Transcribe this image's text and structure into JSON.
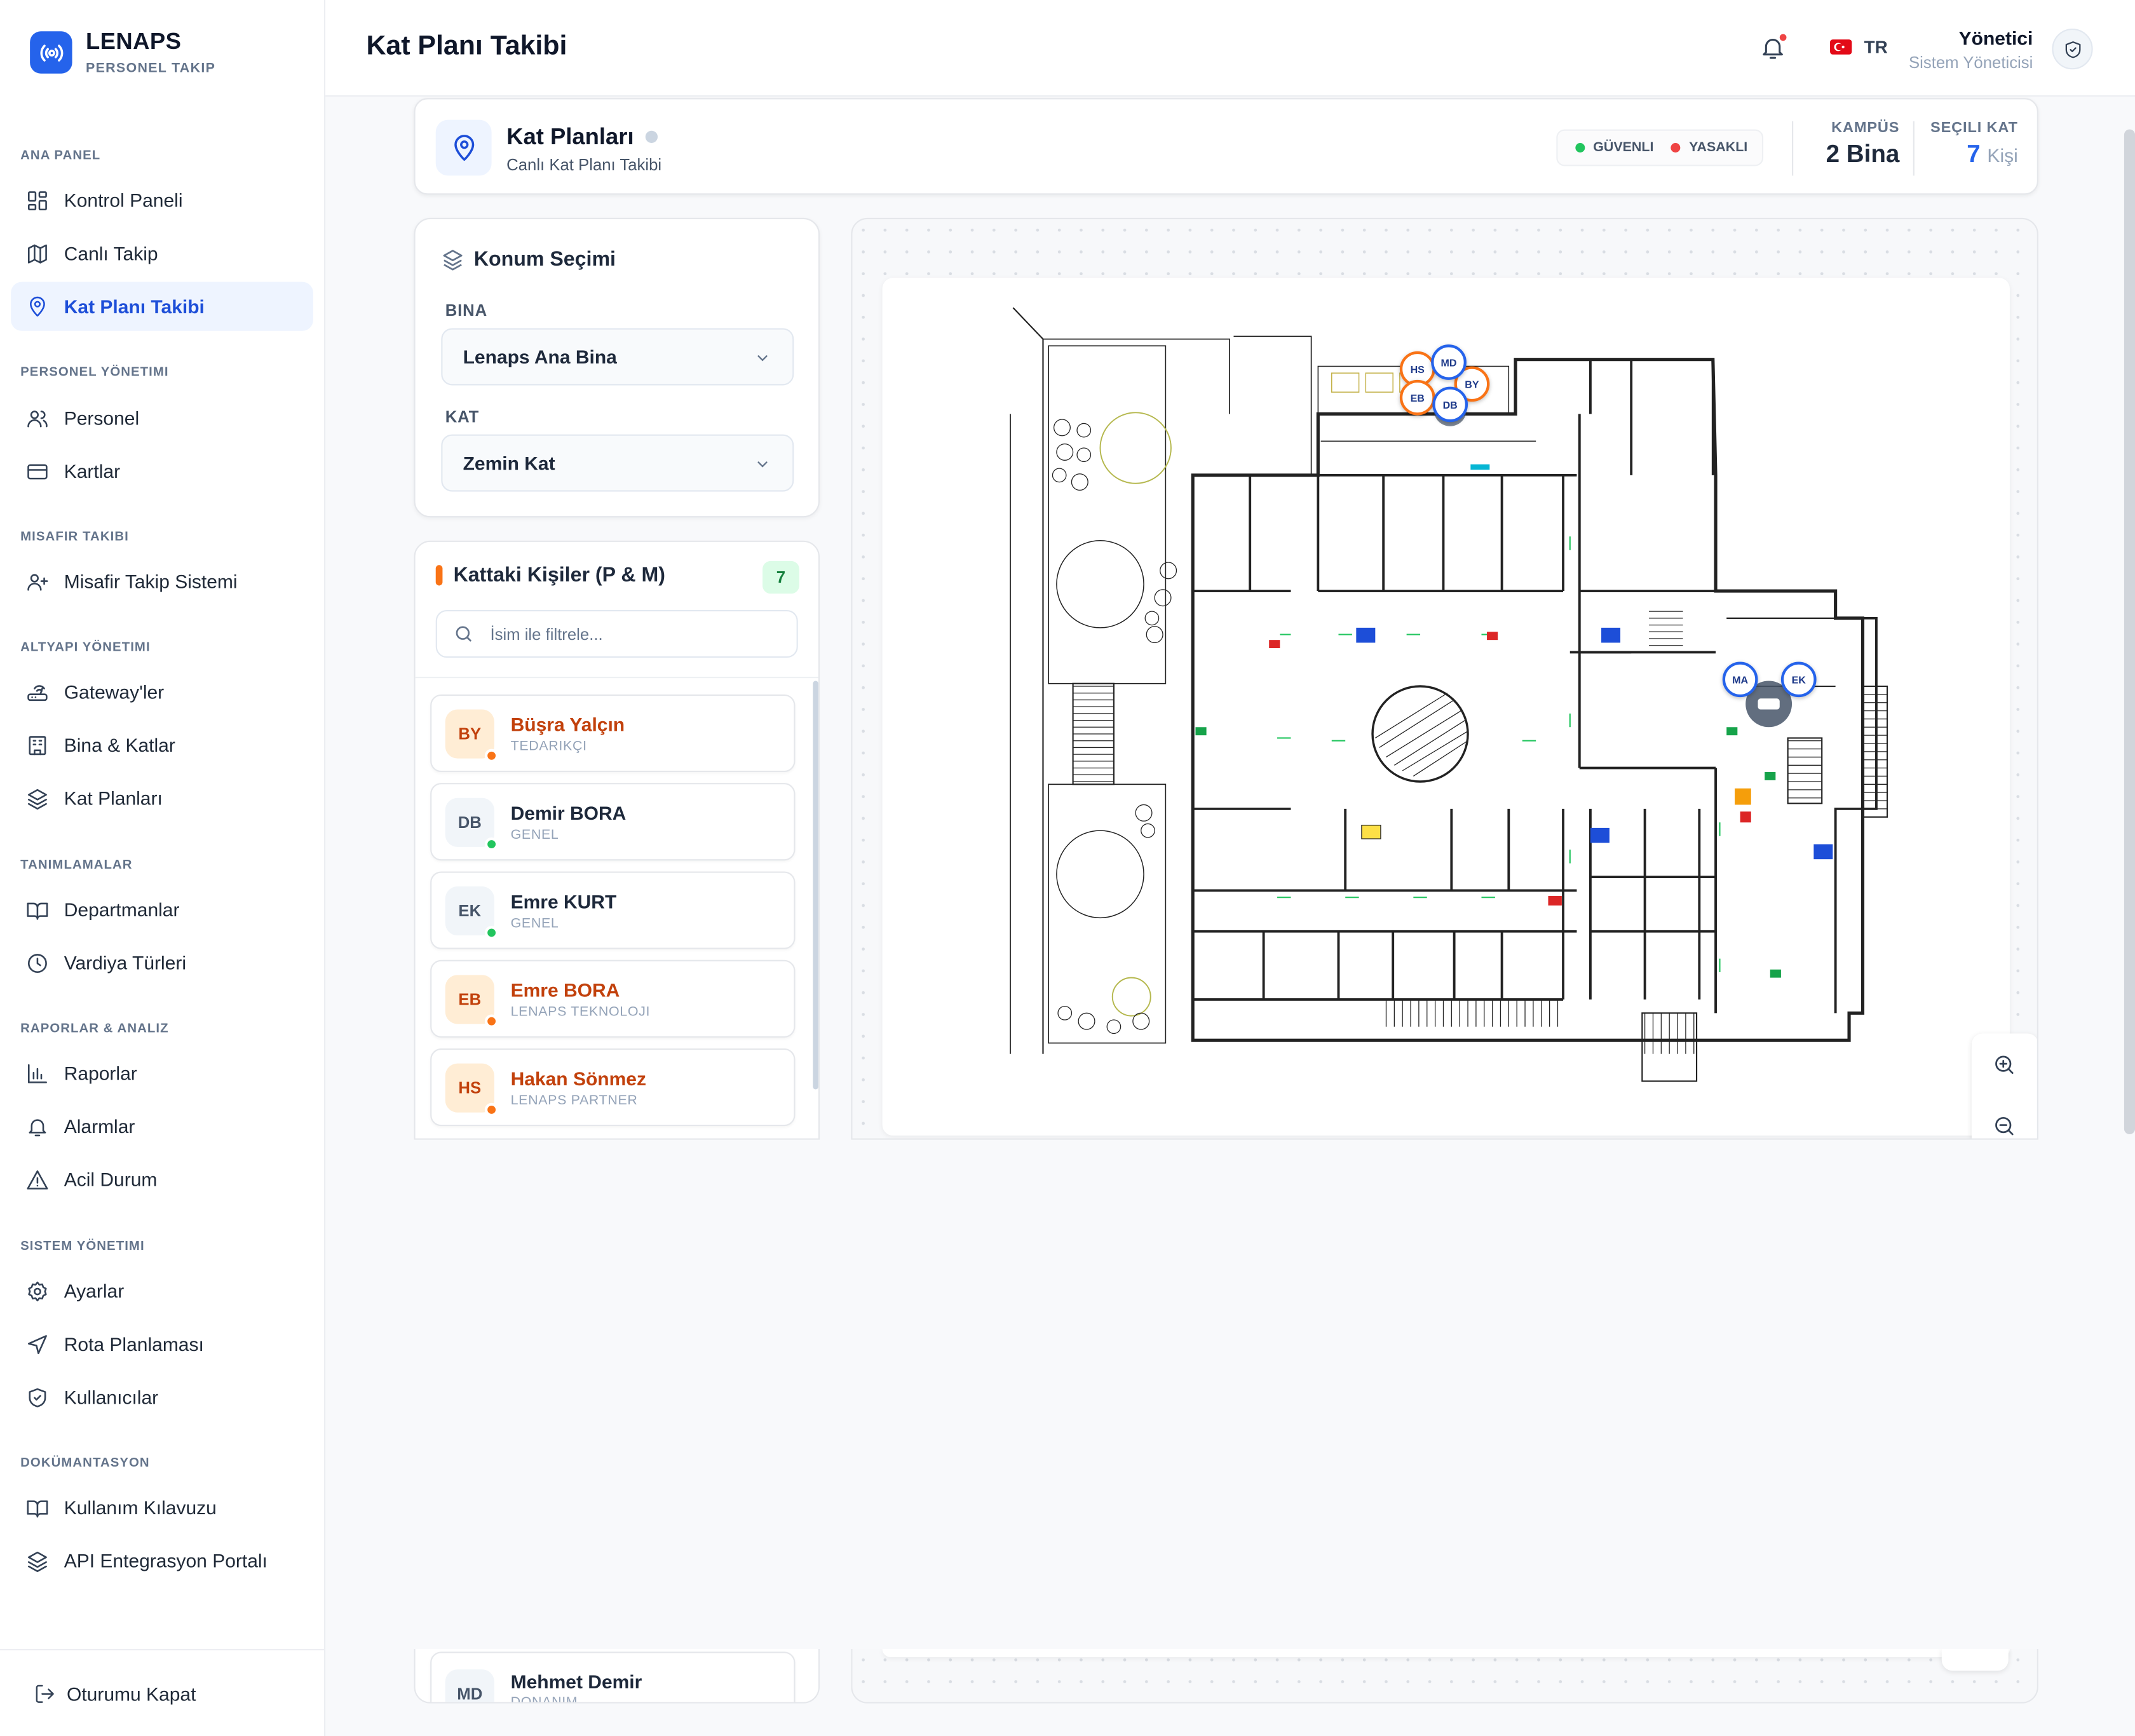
{
  "brand": {
    "title": "LENAPS",
    "subtitle": "PERSONEL TAKIP"
  },
  "sidebar": {
    "sections": [
      {
        "label": "ANA PANEL",
        "items": [
          {
            "label": "Kontrol Paneli",
            "icon": "dashboard-icon"
          },
          {
            "label": "Canlı Takip",
            "icon": "map-icon"
          },
          {
            "label": "Kat Planı Takibi",
            "icon": "map-pin-icon",
            "active": true
          }
        ]
      },
      {
        "label": "PERSONEL YÖNETIMI",
        "items": [
          {
            "label": "Personel",
            "icon": "users-icon"
          },
          {
            "label": "Kartlar",
            "icon": "credit-card-icon"
          }
        ]
      },
      {
        "label": "MISAFIR TAKIBI",
        "items": [
          {
            "label": "Misafir Takip Sistemi",
            "icon": "user-plus-icon"
          }
        ]
      },
      {
        "label": "ALTYAPI YÖNETIMI",
        "items": [
          {
            "label": "Gateway'ler",
            "icon": "router-icon"
          },
          {
            "label": "Bina & Katlar",
            "icon": "building-icon"
          },
          {
            "label": "Kat Planları",
            "icon": "layers-icon"
          }
        ]
      },
      {
        "label": "TANIMLAMALAR",
        "items": [
          {
            "label": "Departmanlar",
            "icon": "book-open-icon"
          },
          {
            "label": "Vardiya Türleri",
            "icon": "clock-icon"
          }
        ]
      },
      {
        "label": "RAPORLAR & ANALIZ",
        "items": [
          {
            "label": "Raporlar",
            "icon": "bar-chart-icon"
          },
          {
            "label": "Alarmlar",
            "icon": "bell-icon"
          },
          {
            "label": "Acil Durum",
            "icon": "alert-triangle-icon"
          }
        ]
      },
      {
        "label": "SISTEM YÖNETIMI",
        "items": [
          {
            "label": "Ayarlar",
            "icon": "gear-icon"
          },
          {
            "label": "Rota Planlaması",
            "icon": "navigation-icon"
          },
          {
            "label": "Kullanıcılar",
            "icon": "shield-check-icon"
          }
        ]
      },
      {
        "label": "DOKÜMANTASYON",
        "items": [
          {
            "label": "Kullanım Kılavuzu",
            "icon": "book-open-icon"
          },
          {
            "label": "API Entegrasyon Portalı",
            "icon": "layers-icon"
          }
        ]
      }
    ],
    "logout": "Oturumu Kapat"
  },
  "header": {
    "title": "Kat Planı Takibi",
    "language": "TR",
    "user_name": "Yönetici",
    "user_role": "Sistem Yöneticisi"
  },
  "floorplans": {
    "title": "Kat Planları",
    "subtitle": "Canlı Kat Planı Takibi",
    "legend": {
      "safe": "GÜVENLI",
      "forbidden": "YASAKLI"
    },
    "campus_label": "KAMPÜS",
    "campus_value": "2 Bina",
    "floor_label": "SEÇILI KAT",
    "floor_count": "7",
    "floor_unit": "Kişi"
  },
  "location": {
    "title": "Konum Seçimi",
    "building_label": "BINA",
    "building_value": "Lenaps Ana Bina",
    "floor_label": "KAT",
    "floor_value": "Zemin Kat"
  },
  "people": {
    "title": "Kattaki Kişiler (P & M)",
    "count": "7",
    "search_placeholder": "İsim ile filtrele...",
    "list": [
      {
        "initials": "BY",
        "name": "Büşra Yalçın",
        "dept": "TEDARIKÇI",
        "guest": true
      },
      {
        "initials": "DB",
        "name": "Demir BORA",
        "dept": "GENEL",
        "guest": false
      },
      {
        "initials": "EK",
        "name": "Emre KURT",
        "dept": "GENEL",
        "guest": false
      },
      {
        "initials": "EB",
        "name": "Emre BORA",
        "dept": "LENAPS TEKNOLOJI",
        "guest": true
      },
      {
        "initials": "HS",
        "name": "Hakan Sönmez",
        "dept": "LENAPS PARTNER",
        "guest": true
      }
    ],
    "partial": {
      "initials": "MD",
      "name": "Mehmet Demir",
      "dept": "DONANIM"
    }
  },
  "map_markers": [
    "HS",
    "MD",
    "EB",
    "DB",
    "BY",
    "MA",
    "EK"
  ],
  "colors": {
    "accent": "#2563eb",
    "guest": "#c2410c",
    "safe": "#22c55e",
    "forbidden": "#ef4444"
  }
}
